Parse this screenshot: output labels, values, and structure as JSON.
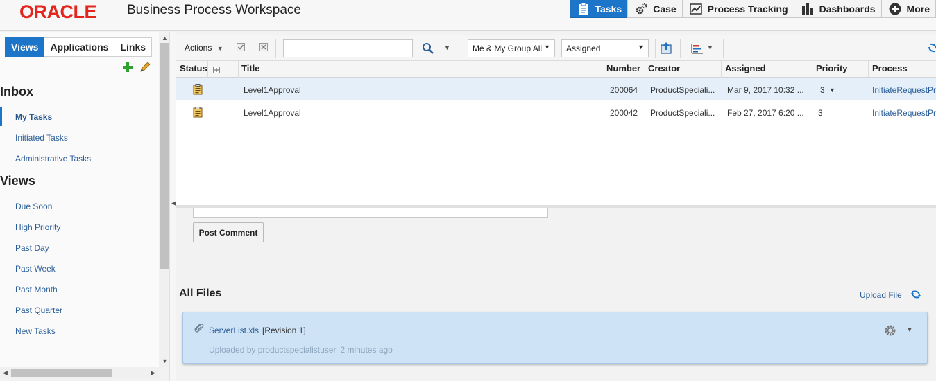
{
  "header": {
    "logo": "ORACLE",
    "title": "Business Process Workspace",
    "nav": [
      {
        "label": "Tasks",
        "icon": "clipboard-icon",
        "active": true
      },
      {
        "label": "Case",
        "icon": "gears-icon"
      },
      {
        "label": "Process Tracking",
        "icon": "line-chart-icon"
      },
      {
        "label": "Dashboards",
        "icon": "bar-chart-icon"
      },
      {
        "label": "More",
        "icon": "plus-circle-icon"
      }
    ]
  },
  "sidebar": {
    "tabs": [
      "Views",
      "Applications",
      "Links"
    ],
    "active_tab": "Views",
    "inbox_title": "Inbox",
    "inbox_items": [
      "My Tasks",
      "Initiated Tasks",
      "Administrative Tasks"
    ],
    "views_title": "Views",
    "view_items": [
      "Due Soon",
      "High Priority",
      "Past Day",
      "Past Week",
      "Past Month",
      "Past Quarter",
      "New Tasks"
    ]
  },
  "toolbar": {
    "actions_label": "Actions",
    "search_value": "",
    "filter_select": "Me & My Group All",
    "state_select": "Assigned"
  },
  "table": {
    "columns": {
      "status": "Status",
      "title": "Title",
      "number": "Number",
      "creator": "Creator",
      "assigned": "Assigned",
      "priority": "Priority",
      "process": "Process"
    },
    "rows": [
      {
        "title": "Level1Approval",
        "number": "200064",
        "creator": "ProductSpeciali...",
        "assigned": "Mar 9, 2017 10:32 ...",
        "priority": "3",
        "process": "InitiateRequestPr"
      },
      {
        "title": "Level1Approval",
        "number": "200042",
        "creator": "ProductSpeciali...",
        "assigned": "Feb 27, 2017 6:20 ...",
        "priority": "3",
        "process": "InitiateRequestPr"
      }
    ]
  },
  "comments": {
    "post_label": "Post Comment"
  },
  "files": {
    "title": "All Files",
    "upload_label": "Upload File",
    "items": [
      {
        "name": "ServerList.xls",
        "revision": "[Revision 1]",
        "uploaded_by": "Uploaded by productspecialistuser",
        "time": "2 minutes ago"
      }
    ]
  },
  "colors": {
    "accent": "#1d75c9",
    "brand": "#e2261d",
    "card": "#cfe3f6",
    "link": "#2b5e99"
  }
}
